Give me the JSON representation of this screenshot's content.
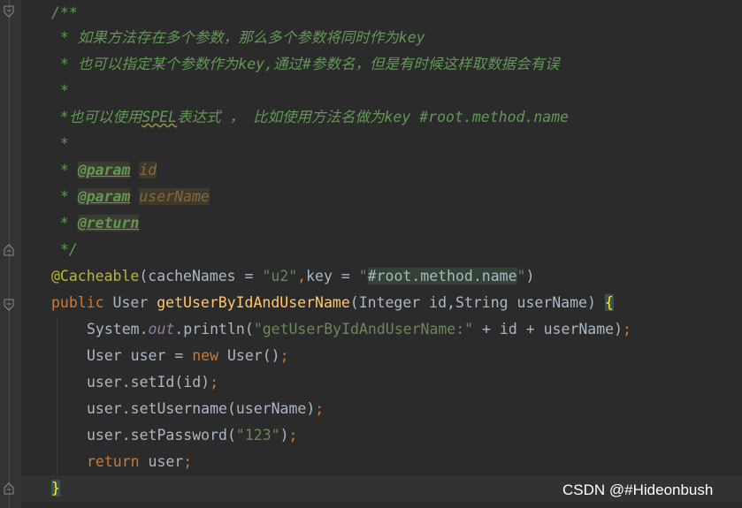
{
  "editor": {
    "lines": {
      "l1": "/**",
      "l2": " * 如果方法存在多个参数，那么多个参数将同时作为key",
      "l3": " * 也可以指定某个参数作为key,通过#参数名，但是有时候这样取数据会有误",
      "l4": " *",
      "l5a": " *也可以使用",
      "l5b": "SPEL",
      "l5c": "表达式 ， 比如使用方法名做为key #root.method.name",
      "l6": " *",
      "l7a": " * ",
      "l7b": "@param",
      "l7c": " ",
      "l7d": "id",
      "l8a": " * ",
      "l8b": "@param",
      "l8c": " ",
      "l8d": "userName",
      "l9a": " * ",
      "l9b": "@return",
      "l10": " */",
      "l11a": "@Cacheable",
      "l11b": "(cacheNames = ",
      "l11c": "\"u2\"",
      "l11d": ",",
      "l11e": "key = ",
      "l11f": "\"",
      "l11g": "#root.method.name",
      "l11h": "\"",
      "l11i": ")",
      "l12a": "public ",
      "l12b": "User ",
      "l12c": "getUserByIdAndUserName",
      "l12d": "(Integer id,String userName) ",
      "l12e": "{",
      "l13a": "System.",
      "l13b": "out",
      "l13c": ".println(",
      "l13d": "\"getUserByIdAndUserName:\"",
      "l13e": " + id + userName)",
      "l13f": ";",
      "l14a": "User user = ",
      "l14b": "new ",
      "l14c": "User()",
      "l14d": ";",
      "l15a": "user.setId(id)",
      "l15b": ";",
      "l16a": "user.setUsername(userName)",
      "l16b": ";",
      "l17a": "user.setPassword(",
      "l17b": "\"123\"",
      "l17c": ")",
      "l17d": ";",
      "l18a": "return ",
      "l18b": "user",
      "l18c": ";",
      "l19": "}"
    }
  },
  "watermark": "CSDN @#Hideonbush",
  "colors": {
    "background": "#2b2b2b",
    "comment": "#629755",
    "keyword": "#cc7832",
    "string": "#6a8759",
    "annotation": "#bbb529",
    "method": "#ffc66d",
    "default_text": "#a9b7c6"
  }
}
